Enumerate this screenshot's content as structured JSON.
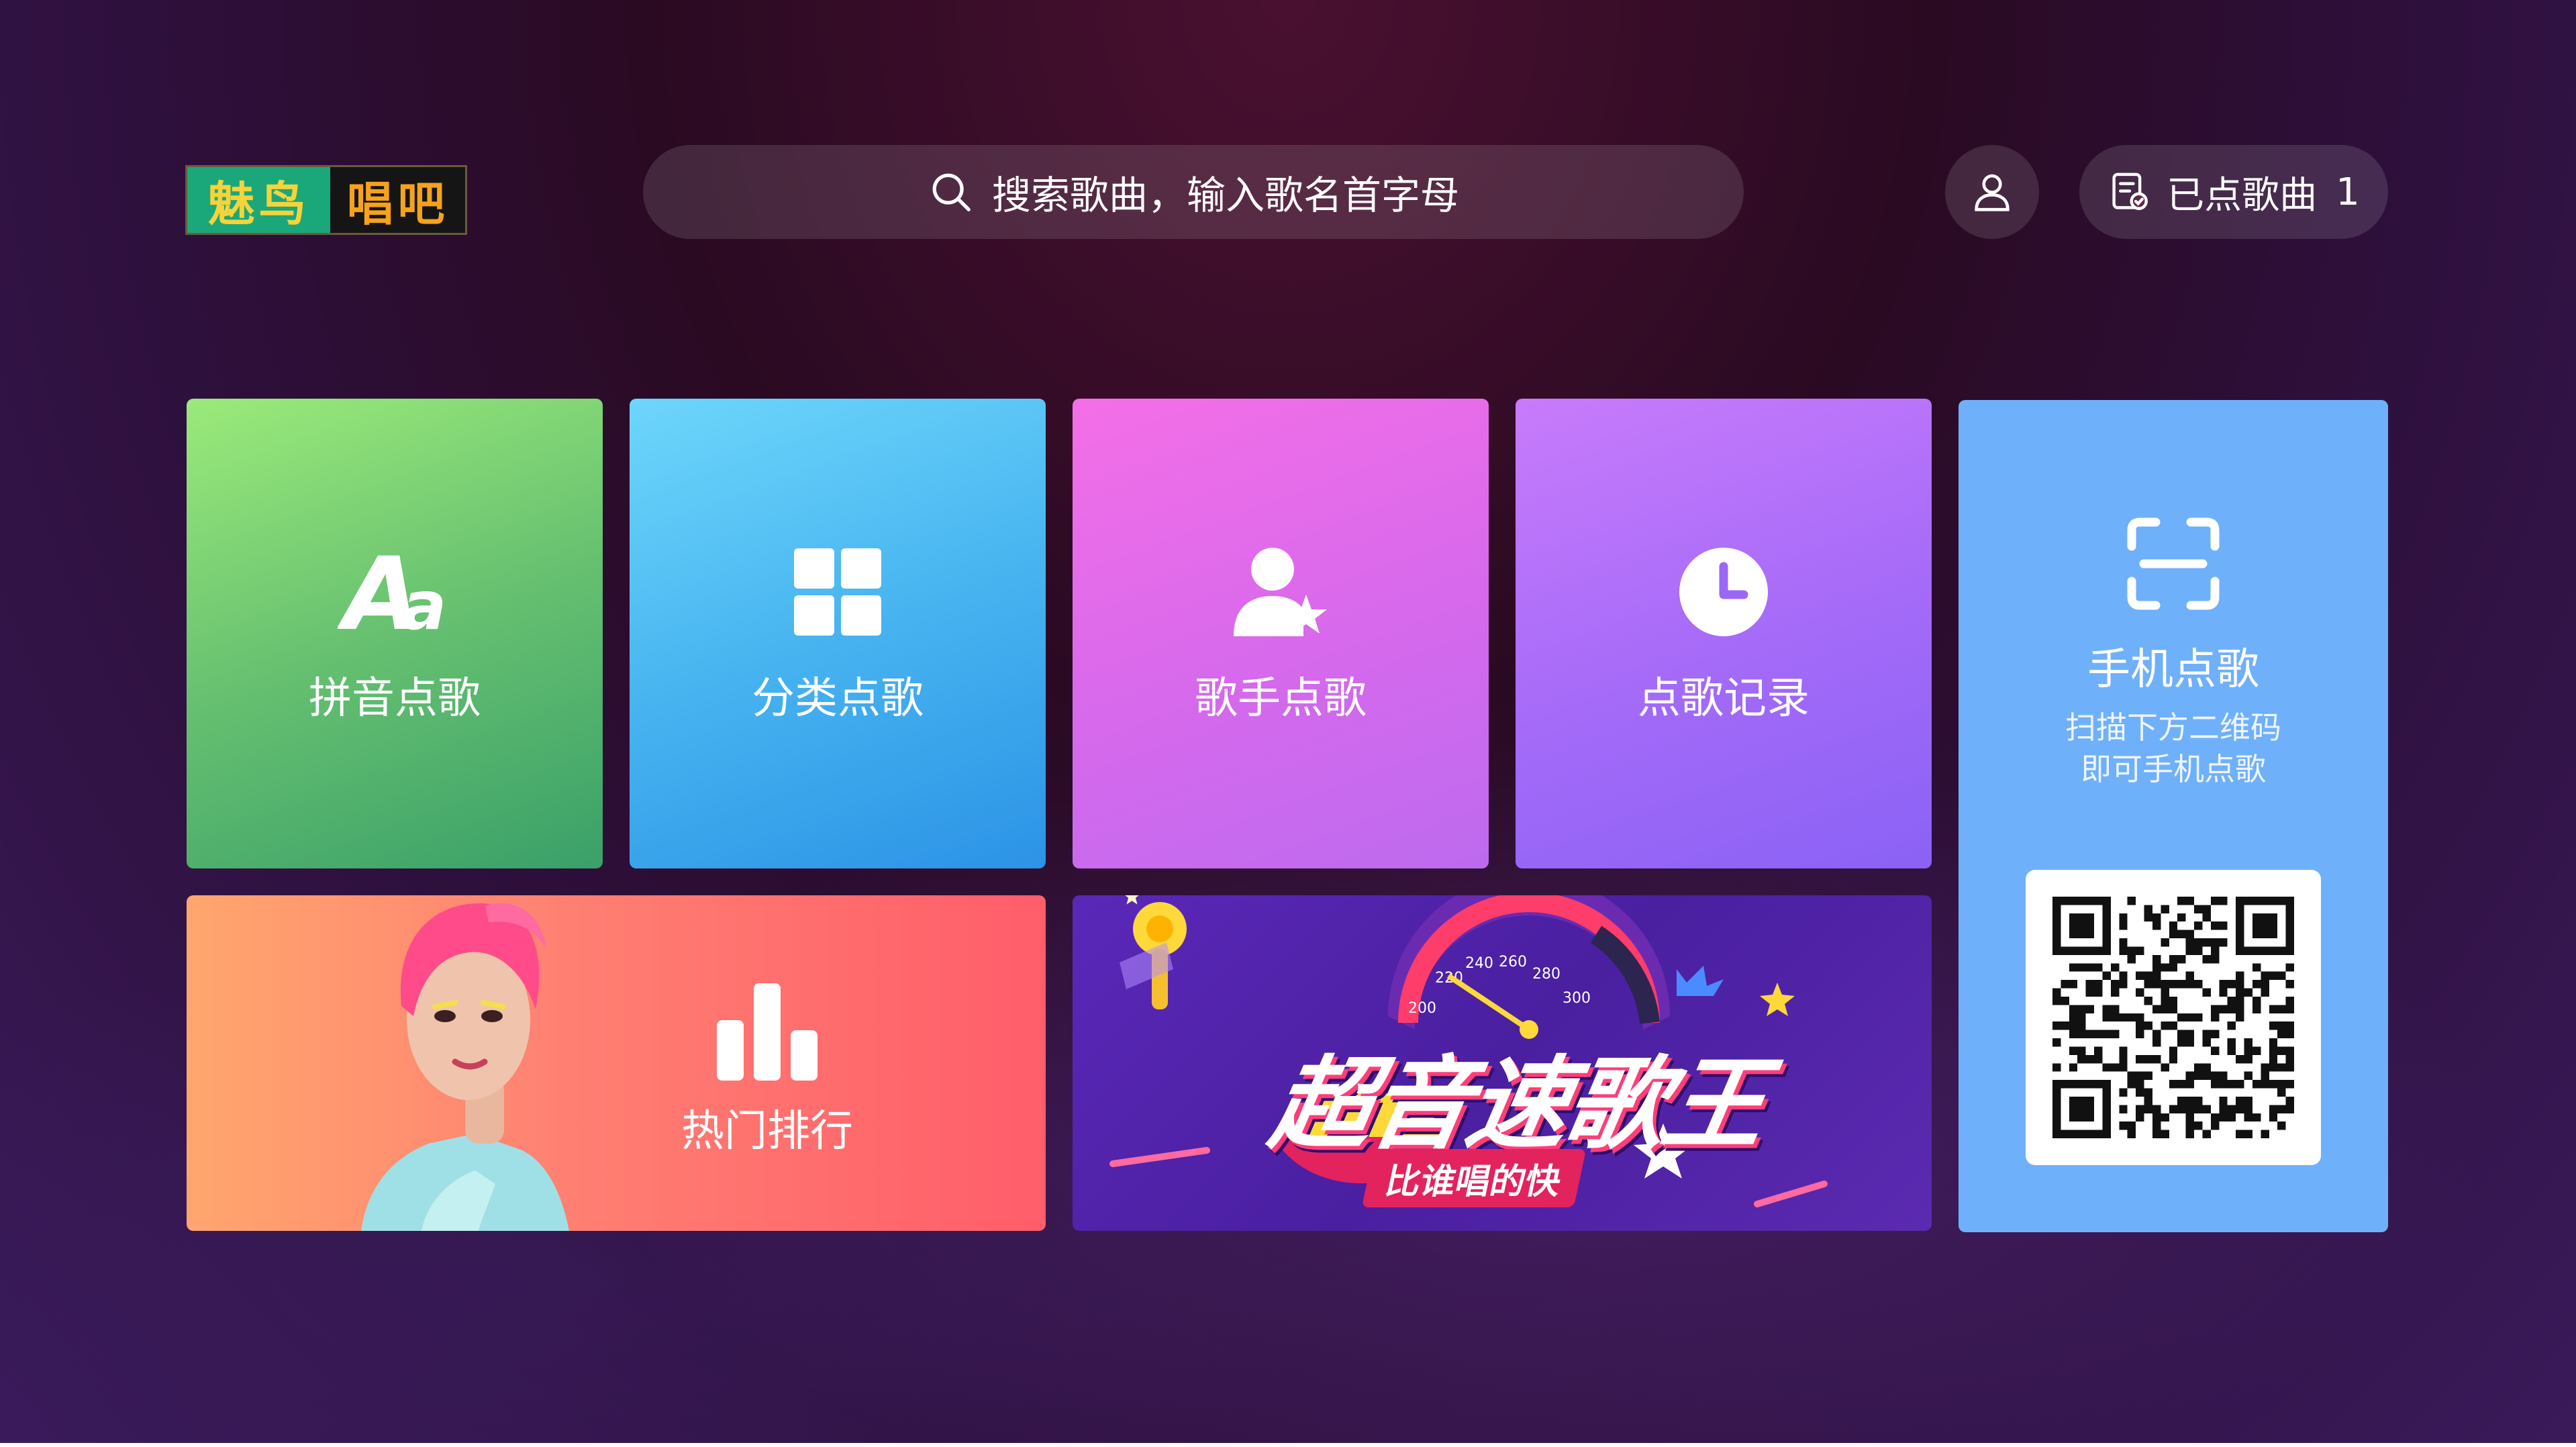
{
  "brand": {
    "part1": "魅鸟",
    "part2": "唱吧"
  },
  "search": {
    "placeholder": "搜索歌曲，输入歌名首字母"
  },
  "playlist": {
    "label": "已点歌曲",
    "count": "1"
  },
  "tiles": [
    {
      "label": "拼音点歌",
      "icon": "pinyin-icon"
    },
    {
      "label": "分类点歌",
      "icon": "grid-icon"
    },
    {
      "label": "歌手点歌",
      "icon": "singer-star-icon"
    },
    {
      "label": "点歌记录",
      "icon": "clock-icon"
    }
  ],
  "mobile": {
    "title": "手机点歌",
    "desc_line1": "扫描下方二维码",
    "desc_line2": "即可手机点歌",
    "icon": "scan-icon"
  },
  "hot": {
    "label": "热门排行",
    "icon": "bar-chart-icon"
  },
  "banner": {
    "title": "超音速歌王",
    "subtitle": "比谁唱的快",
    "speed_ticks": [
      "200",
      "220",
      "240",
      "260",
      "280",
      "300"
    ]
  },
  "colors": {
    "accent_green": "#1aa87a",
    "brand_yellow": "#f6d33a",
    "brand_orange": "#f7a21b",
    "qr_tile": "#6fb0fb"
  }
}
